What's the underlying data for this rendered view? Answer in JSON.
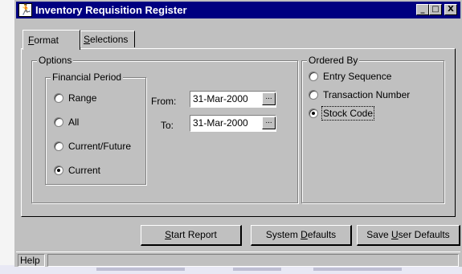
{
  "window": {
    "title": "Inventory Requisition Register",
    "icon": "runner-icon",
    "controls": {
      "minimize": "_",
      "maximize": "□",
      "close": "X"
    }
  },
  "tabs": {
    "format": {
      "pre": "",
      "key": "F",
      "post": "ormat"
    },
    "selections": {
      "pre": "",
      "key": "S",
      "post": "elections"
    },
    "active": "Format"
  },
  "options": {
    "label": "Options",
    "financial_period": {
      "label": "Financial Period",
      "items": [
        "Range",
        "All",
        "Current/Future",
        "Current"
      ],
      "selected": "Current"
    },
    "from_label": "From:",
    "from_value": "31-Mar-2000",
    "to_label": "To:",
    "to_value": "31-Mar-2000",
    "picker_glyph": "..."
  },
  "ordered_by": {
    "label": "Ordered By",
    "items": [
      "Entry Sequence",
      "Transaction Number",
      "Stock Code"
    ],
    "selected": "Stock Code"
  },
  "buttons": {
    "start_report": {
      "pre": "",
      "key": "S",
      "post": "tart Report"
    },
    "system_defaults": {
      "pre": "System ",
      "key": "D",
      "post": "efaults"
    },
    "save_user_defaults": {
      "pre": "Save ",
      "key": "U",
      "post": "ser Defaults"
    }
  },
  "status": {
    "help": "Help",
    "message": ""
  },
  "colors": {
    "face": "#c0c0c0",
    "title_bar": "#000080",
    "title_text": "#ffffff"
  }
}
